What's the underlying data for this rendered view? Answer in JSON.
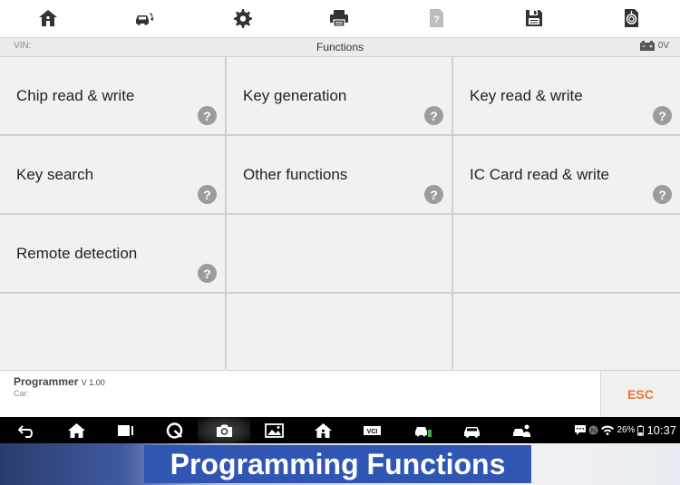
{
  "toolbar": {
    "icons": [
      "home-icon",
      "vehicle-swap-icon",
      "gear-icon",
      "print-icon",
      "help-disabled-icon",
      "save-icon",
      "datalogging-icon"
    ]
  },
  "infobar": {
    "vin_label": "VIN:",
    "title": "Functions",
    "voltage": "0V"
  },
  "functions": [
    {
      "label": "Chip read & write",
      "help": "?"
    },
    {
      "label": "Key generation",
      "help": "?"
    },
    {
      "label": "Key read & write",
      "help": "?"
    },
    {
      "label": "Key search",
      "help": "?"
    },
    {
      "label": "Other functions",
      "help": "?"
    },
    {
      "label": "IC Card read & write",
      "help": "?"
    },
    {
      "label": "Remote detection",
      "help": "?"
    }
  ],
  "footer": {
    "app_name": "Programmer",
    "version": "V 1.00",
    "car_label": "Car:",
    "esc_label": "ESC"
  },
  "statusbar": {
    "battery": "26%",
    "time": "10:37"
  },
  "banner": {
    "title": "Programming Functions"
  },
  "colors": {
    "accent_esc": "#e8772e",
    "tile_bg": "#f1f1f1",
    "banner_blue": "#2f56b3"
  }
}
